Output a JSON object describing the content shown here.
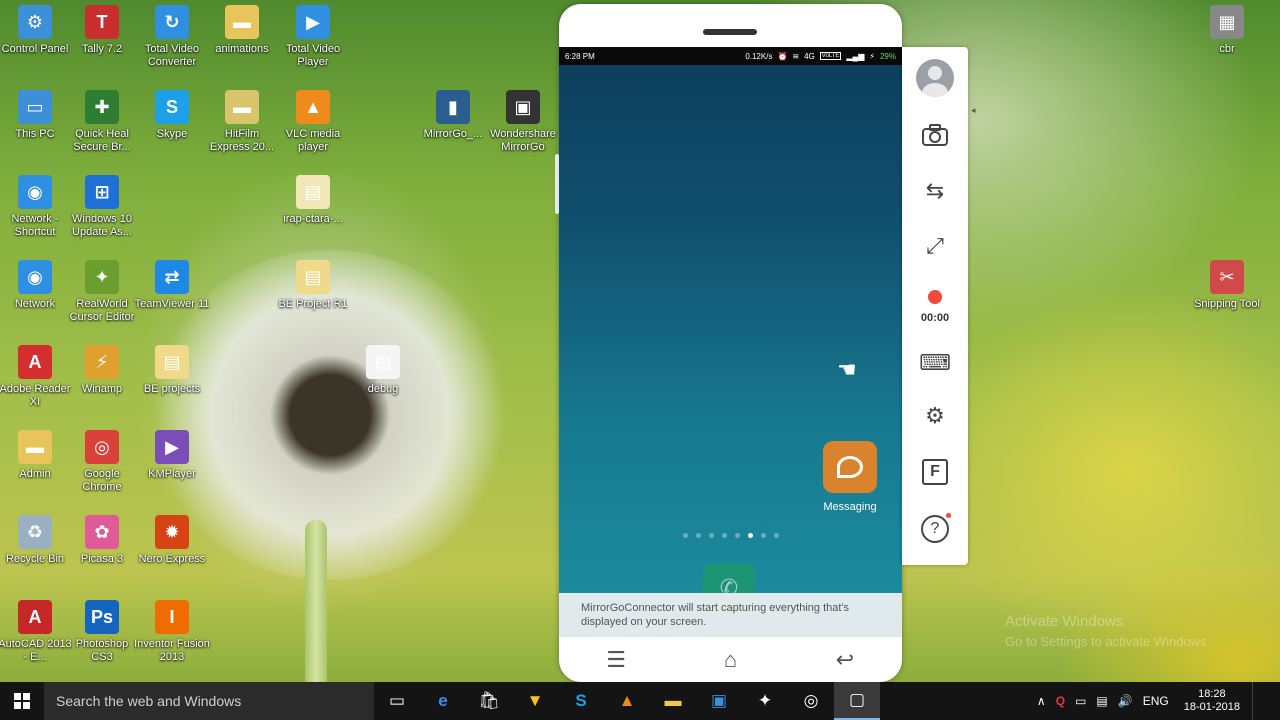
{
  "desktop": {
    "icons": [
      {
        "label": "Control Panel",
        "glyph": "⚙",
        "color": "#3d8fd6"
      },
      {
        "label": "Tally 7.2",
        "glyph": "T",
        "color": "#c82e2e"
      },
      {
        "label": "Total Video Converter",
        "glyph": "↻",
        "color": "#2f8fe0"
      },
      {
        "label": "animations",
        "glyph": "▬",
        "color": "#e8c55a"
      },
      {
        "label": "Total Video Player",
        "glyph": "▶",
        "color": "#2f8fe0"
      },
      {
        "label": "This PC",
        "glyph": "▭",
        "color": "#3d8fd6"
      },
      {
        "label": "Quick Heal Secure Br...",
        "glyph": "✚",
        "color": "#2e7d32"
      },
      {
        "label": "Skype",
        "glyph": "S",
        "color": "#1ea0e8"
      },
      {
        "label": "HitFilm Express 20...",
        "glyph": "▬",
        "color": "#d8c46a"
      },
      {
        "label": "VLC media player",
        "glyph": "▲",
        "color": "#f08a1c"
      },
      {
        "label": "MirrorGo_...",
        "glyph": "▮",
        "color": "#2a5e8f"
      },
      {
        "label": "Wondershare MirrorGo",
        "glyph": "▣",
        "color": "#333333"
      },
      {
        "label": "Network - Shortcut",
        "glyph": "◉",
        "color": "#2f8fe0"
      },
      {
        "label": "Windows 10 Update As...",
        "glyph": "⊞",
        "color": "#1e6fd6"
      },
      {
        "label": "irap-ctara-...",
        "glyph": "▤",
        "color": "#f1e7b8"
      },
      {
        "label": "Network",
        "glyph": "◉",
        "color": "#2f8fe0"
      },
      {
        "label": "RealWorld Cursor Editor",
        "glyph": "✦",
        "color": "#6a9e2f"
      },
      {
        "label": "TeamViewer 11",
        "glyph": "⇄",
        "color": "#1e88e5"
      },
      {
        "label": "BE Project R1",
        "glyph": "▤",
        "color": "#f1d98a"
      },
      {
        "label": "Adobe Reader XI",
        "glyph": "A",
        "color": "#d32f2f"
      },
      {
        "label": "Winamp",
        "glyph": "⚡",
        "color": "#e0a030"
      },
      {
        "label": "BE projects",
        "glyph": "▤",
        "color": "#f1d98a"
      },
      {
        "label": "debug",
        "glyph": "▤",
        "color": "#f5f5f5"
      },
      {
        "label": "Admin",
        "glyph": "▬",
        "color": "#e8c55a"
      },
      {
        "label": "Google Chrome",
        "glyph": "◎",
        "color": "#d9413a"
      },
      {
        "label": "KMPlayer",
        "glyph": "▶",
        "color": "#7b4db8"
      },
      {
        "label": "Recycle Bin",
        "glyph": "♻",
        "color": "#9ab0c0"
      },
      {
        "label": "Picasa 3",
        "glyph": "✿",
        "color": "#e05a9a"
      },
      {
        "label": "Nero Express",
        "glyph": "✹",
        "color": "#d84315"
      },
      {
        "label": "AutoCAD 2013 - E...",
        "glyph": "A",
        "color": "#c62828"
      },
      {
        "label": "Photoshop CS3",
        "glyph": "Ps",
        "color": "#1565c0"
      },
      {
        "label": "Inventor Fusion 2013",
        "glyph": "I",
        "color": "#ef6c00"
      },
      {
        "label": "cbr",
        "glyph": "▦",
        "color": "#888888"
      },
      {
        "label": "Snipping Tool",
        "glyph": "✂",
        "color": "#d04a4a"
      }
    ]
  },
  "phone": {
    "status": {
      "time": "6:28 PM",
      "speed": "0.12K/s",
      "network": "4G",
      "volte": "VoLTE",
      "battery": "29%"
    },
    "apps": {
      "messaging_label": "Messaging"
    },
    "toast": "MirrorGoConnector will start capturing everything that's displayed on your screen.",
    "nav": {
      "menu": "☰",
      "home": "⌂",
      "back": "↩"
    }
  },
  "toolpanel": {
    "record_time": "00:00",
    "f_label": "F",
    "help_label": "?"
  },
  "watermark": {
    "line1": "Activate Windows",
    "line2": "Go to Settings to activate Windows."
  },
  "taskbar": {
    "search_placeholder": "Search the web and Windows",
    "tray_language": "ENG",
    "clock_time": "18:28",
    "clock_date": "18-01-2018"
  }
}
